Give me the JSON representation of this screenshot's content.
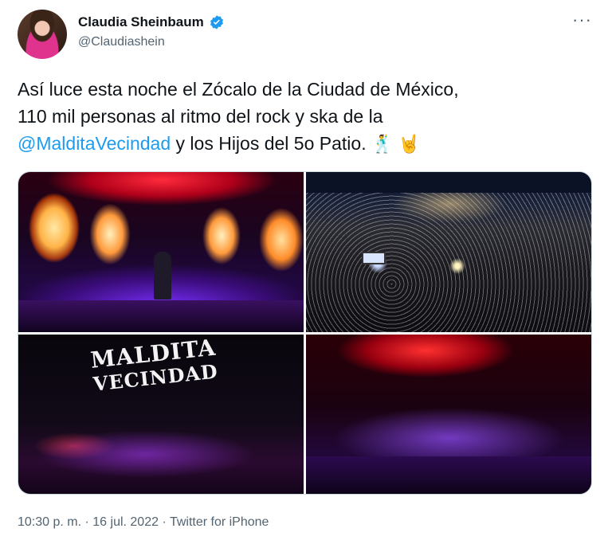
{
  "author": {
    "display_name": "Claudia Sheinbaum",
    "handle": "@Claudiashein",
    "verified": true
  },
  "more_label": "···",
  "tweet": {
    "line1": "Así luce esta noche el Zócalo de la Ciudad de México,",
    "line2": "110 mil personas al ritmo del rock y ska de la",
    "mention": "@MalditaVecindad",
    "line3_rest": " y los Hijos del 5o Patio.",
    "emoji1": "🕺",
    "emoji2": "🤘"
  },
  "media": {
    "logo_line1": "MALDITA",
    "logo_line2": "VECINDAD"
  },
  "footer": {
    "time": "10:30 p. m.",
    "sep1": " · ",
    "date": "16 jul. 2022",
    "sep2": " · ",
    "source": "Twitter for iPhone"
  },
  "colors": {
    "accent": "#1d9bf0",
    "muted": "#536471"
  }
}
